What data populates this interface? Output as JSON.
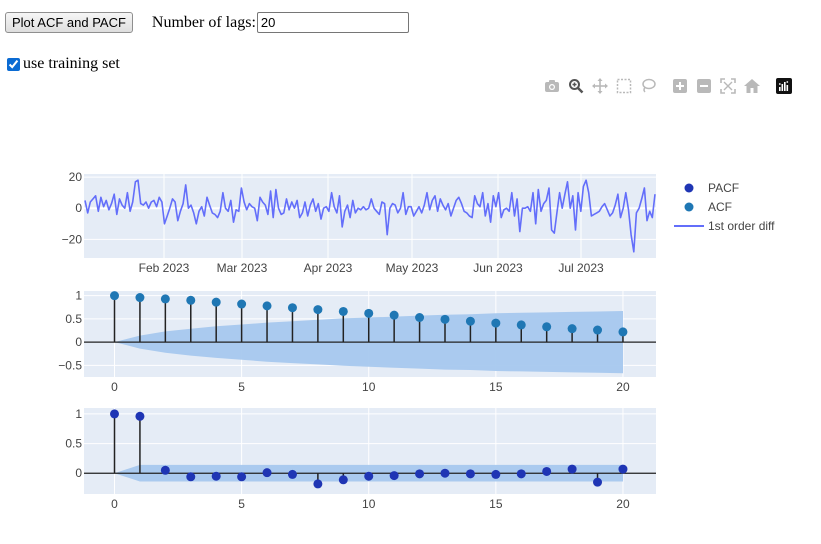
{
  "controls": {
    "plot_button_label": "Plot ACF and PACF",
    "lags_label": "Number of lags:",
    "lags_value": "20",
    "use_training_label": "use training set",
    "use_training_checked": true
  },
  "modebar": [
    "camera-icon",
    "zoom-icon",
    "pan-icon",
    "box-select-icon",
    "lasso-select-icon",
    "zoom-in-icon",
    "zoom-out-icon",
    "autoscale-icon",
    "reset-axes-icon",
    "plotly-logo-icon"
  ],
  "legend": {
    "pacf_label": "PACF",
    "acf_label": "ACF",
    "diff_label": "1st order diff"
  },
  "colors": {
    "pacf": "#1f35b4",
    "acf": "#1f77b4",
    "diff_line": "#636efa",
    "plot_bg": "#e5ecf6",
    "conf_band": "#a6c8ee",
    "stem": "#222222"
  },
  "chart_data": [
    {
      "type": "line",
      "series": [
        {
          "name": "1st order diff",
          "values": [
            5,
            -3,
            4,
            6,
            8,
            -2,
            7,
            1,
            5,
            -1,
            3,
            9,
            -4,
            6,
            2,
            0,
            10,
            -2,
            4,
            17,
            18,
            3,
            2,
            4,
            0,
            4,
            5,
            1,
            7,
            4,
            -10,
            -5,
            0,
            6,
            4,
            -8,
            -2,
            3,
            15,
            0,
            2,
            -3,
            -10,
            -2,
            1,
            -5,
            7,
            2,
            -3,
            -4,
            -6,
            -2,
            10,
            0,
            -2,
            5,
            -9,
            -1,
            -2,
            13,
            4,
            -1,
            3,
            1,
            0,
            -8,
            7,
            4,
            2,
            -4,
            11,
            -6,
            12,
            0,
            -4,
            -3,
            6,
            -1,
            4,
            0,
            5,
            -6,
            -3,
            4,
            -5,
            2,
            6,
            -2,
            3,
            -7,
            0,
            1,
            -2,
            10,
            1,
            -3,
            8,
            -12,
            -2,
            2,
            -6,
            5,
            -3,
            0,
            -1,
            1,
            -1,
            0,
            6,
            0,
            -2,
            -4,
            4,
            3,
            -17,
            0,
            3,
            2,
            -3,
            0,
            10,
            -4,
            1,
            1,
            -5,
            -2,
            1,
            -3,
            2,
            10,
            -1,
            5,
            8,
            -2,
            6,
            2,
            -1,
            3,
            -5,
            0,
            5,
            7,
            3,
            -2,
            -3,
            -5,
            -6,
            8,
            3,
            1,
            10,
            -5,
            3,
            -9,
            8,
            1,
            10,
            -6,
            -1,
            0,
            -2,
            10,
            -5,
            6,
            -15,
            0,
            0,
            1,
            -2,
            10,
            -10,
            12,
            -2,
            3,
            5,
            13,
            -14,
            -16,
            -3,
            10,
            0,
            9,
            17,
            0,
            8,
            -14,
            10,
            -2,
            14,
            18,
            10,
            -5,
            -4,
            -3,
            -2,
            1,
            3,
            -1,
            -5,
            -3,
            2,
            9,
            -6,
            0,
            10,
            -1,
            -17,
            -28,
            -3,
            0,
            6,
            13,
            -8,
            -2,
            -6,
            9
          ]
        }
      ],
      "x_tick_labels": [
        "Feb 2023",
        "Mar 2023",
        "Apr 2023",
        "May 2023",
        "Jun 2023",
        "Jul 2023"
      ],
      "y_ticks": [
        20,
        0,
        -20
      ],
      "ylim": [
        -32,
        22
      ]
    },
    {
      "type": "scatter",
      "name": "ACF",
      "lags": [
        0,
        1,
        2,
        3,
        4,
        5,
        6,
        7,
        8,
        9,
        10,
        11,
        12,
        13,
        14,
        15,
        16,
        17,
        18,
        19,
        20
      ],
      "values": [
        1.0,
        0.96,
        0.93,
        0.9,
        0.86,
        0.82,
        0.78,
        0.74,
        0.7,
        0.66,
        0.62,
        0.58,
        0.53,
        0.49,
        0.45,
        0.41,
        0.37,
        0.33,
        0.29,
        0.26,
        0.22
      ],
      "conf_upper": [
        0.0,
        0.14,
        0.23,
        0.29,
        0.34,
        0.38,
        0.42,
        0.45,
        0.48,
        0.51,
        0.53,
        0.55,
        0.57,
        0.59,
        0.6,
        0.62,
        0.63,
        0.64,
        0.65,
        0.66,
        0.67
      ],
      "x_ticks": [
        0,
        5,
        10,
        15,
        20
      ],
      "y_ticks": [
        "1",
        "0.5",
        "0",
        "−0.5"
      ],
      "y_tick_values": [
        1,
        0.5,
        0,
        -0.5
      ],
      "xlim": [
        -1.2,
        21.3
      ],
      "ylim": [
        -0.75,
        1.1
      ]
    },
    {
      "type": "scatter",
      "name": "PACF",
      "lags": [
        0,
        1,
        2,
        3,
        4,
        5,
        6,
        7,
        8,
        9,
        10,
        11,
        12,
        13,
        14,
        15,
        16,
        17,
        18,
        19,
        20
      ],
      "values": [
        1.0,
        0.96,
        0.05,
        -0.06,
        -0.05,
        -0.06,
        0.01,
        -0.02,
        -0.18,
        -0.11,
        -0.05,
        -0.04,
        -0.01,
        0.0,
        -0.01,
        -0.02,
        -0.01,
        0.03,
        0.07,
        -0.15,
        0.07
      ],
      "conf_upper": [
        0.0,
        0.14,
        0.14,
        0.14,
        0.14,
        0.14,
        0.14,
        0.14,
        0.14,
        0.14,
        0.14,
        0.14,
        0.14,
        0.14,
        0.14,
        0.14,
        0.14,
        0.14,
        0.14,
        0.14,
        0.14
      ],
      "x_ticks": [
        0,
        5,
        10,
        15,
        20
      ],
      "y_ticks": [
        "1",
        "0.5",
        "0"
      ],
      "y_tick_values": [
        1,
        0.5,
        0
      ],
      "xlim": [
        -1.2,
        21.3
      ],
      "ylim": [
        -0.35,
        1.1
      ]
    }
  ]
}
